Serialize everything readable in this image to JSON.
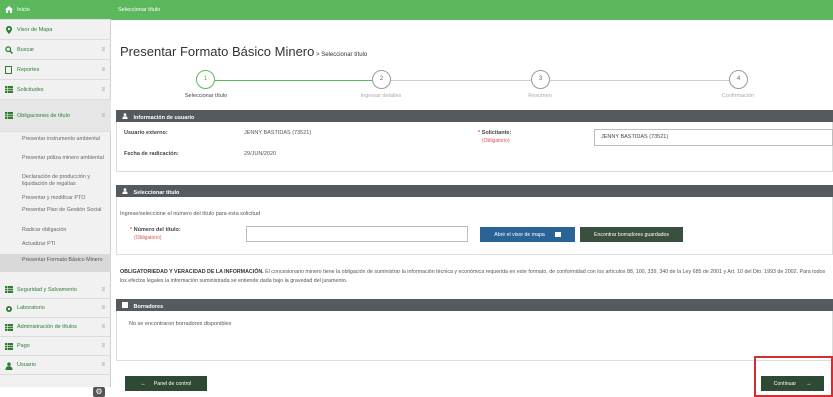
{
  "topbar": {
    "title": "Seleccionar título"
  },
  "page": {
    "title": "Presentar Formato Básico Minero",
    "subtitle": " > Seleccionar título"
  },
  "sidebar": {
    "items": [
      {
        "label": "Inicio",
        "icon": "home-icon"
      },
      {
        "label": "Visor de Mapa",
        "icon": "map-marker-icon"
      },
      {
        "label": "Buscar",
        "icon": "search-icon"
      },
      {
        "label": "Reportes",
        "icon": "report-icon"
      },
      {
        "label": "Solicitudes",
        "icon": "grid-icon"
      },
      {
        "label": "Obligaciones de título",
        "icon": "grid-icon"
      }
    ],
    "sub_items": [
      "Presentar instrumento ambiental",
      "Presentar póliza minero ambiental",
      "Declaración de producción y liquidación de regalías",
      "Presentar y modificar PTO",
      "Presentar Plan de Gestión Social",
      "Radicar obligación",
      "Actualizar PTI",
      "Presentar Formato Básico Minero"
    ],
    "bottom_items": [
      {
        "label": "Seguridad y Salvamento",
        "icon": "grid-icon"
      },
      {
        "label": "Laboratorio",
        "icon": "gear-icon"
      },
      {
        "label": "Administración de títulos",
        "icon": "grid-icon"
      },
      {
        "label": "Pago",
        "icon": "grid-icon"
      },
      {
        "label": "Usuario",
        "icon": "user-icon"
      }
    ]
  },
  "stepper": {
    "steps": [
      {
        "num": "1",
        "label": "Seleccionar título"
      },
      {
        "num": "2",
        "label": "Ingresar detalles"
      },
      {
        "num": "3",
        "label": "Resumen"
      },
      {
        "num": "4",
        "label": "Confirmación"
      }
    ]
  },
  "user_info": {
    "heading": "Información de usuario",
    "external_user_label": "Usuario externo:",
    "external_user_value": "JENNY BASTIDAS (73521)",
    "filing_date_label": "Fecha de radicación:",
    "filing_date_value": "29/JUN/2020",
    "applicant_label": "Solicitante:",
    "applicant_required": "(Obligatorio)",
    "applicant_value": "JENNY BASTIDAS (73521)"
  },
  "select_title": {
    "heading": "Seleccionar título",
    "instruction": "Ingrese/seleccione el número del título para esta solicitud",
    "number_label": "Número del título:",
    "number_required": "(Obligatorio)",
    "number_value": "",
    "map_viewer_button": "Abrir el visor de mapa",
    "find_drafts_button": "Encontrar borradores guardados"
  },
  "notice": {
    "bold": "OBLIGATORIEDAD Y VERACIDAD DE LA INFORMACIÓN.",
    "text": " El concesionario minero tiene la obligación de suministrar la información técnica y económica requerida en este formato, de conformidad con los artículos 88, 100, 339, 340 de la Ley 685 de 2001 y Art. 10 del Dto. 1993 de 2002. Para todos los efectos legales la información suministrada se entiende dada bajo la gravedad del juramento."
  },
  "drafts": {
    "heading": "Borradores",
    "empty_text": "No se encontraron borradores disponibles"
  },
  "footer": {
    "control_panel_button": "Panel de control",
    "continue_button": "Continuar"
  },
  "colors": {
    "accent_green": "#5cb85c",
    "panel_header": "#555a5f",
    "primary_blue": "#2a6496",
    "highlight_red": "#d32f2f"
  }
}
